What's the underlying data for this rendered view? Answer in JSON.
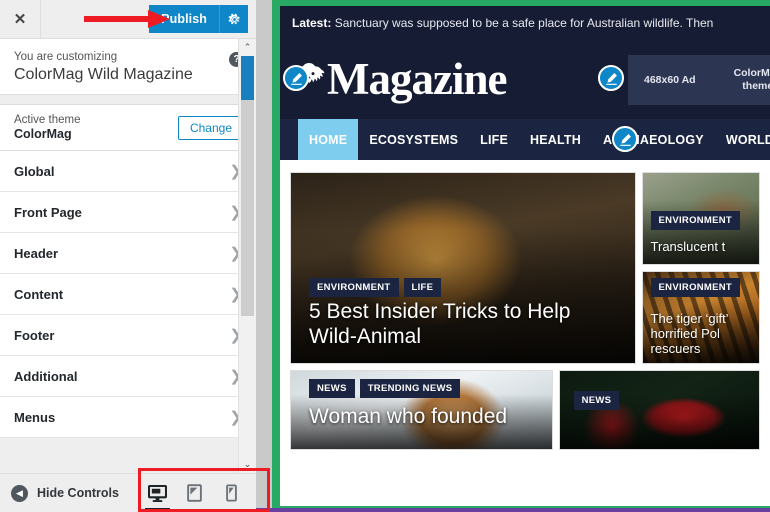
{
  "customizer": {
    "close_label": "✕",
    "publish_label": "Publish",
    "publish_gear_name": "gear-icon",
    "customizing_label": "You are customizing",
    "site_title": "ColorMag Wild Magazine",
    "help_label": "?",
    "active_theme_label": "Active theme",
    "active_theme_name": "ColorMag",
    "change_label": "Change",
    "panels": [
      {
        "label": "Global"
      },
      {
        "label": "Front Page"
      },
      {
        "label": "Header"
      },
      {
        "label": "Content"
      },
      {
        "label": "Footer"
      },
      {
        "label": "Additional"
      },
      {
        "label": "Menus"
      }
    ],
    "chevron": "❯",
    "footer": {
      "hide_controls_label": "Hide Controls",
      "devices": [
        {
          "name": "desktop",
          "active": true
        },
        {
          "name": "tablet",
          "active": false
        },
        {
          "name": "mobile",
          "active": false
        }
      ]
    },
    "scroll_up": "⌃",
    "scroll_down": "⌄"
  },
  "preview": {
    "ticker_prefix": "Latest:",
    "ticker_text": "Sanctuary was supposed to be a safe place for Australian wildlife. Then",
    "logo_text": "Magazine",
    "lion_glyph": "🦁",
    "ad": {
      "size_label": "468x60 Ad",
      "theme_line1": "ColorMag",
      "theme_line2": "theme"
    },
    "nav": [
      {
        "label": "HOME",
        "active": true
      },
      {
        "label": "ECOSYSTEMS",
        "active": false
      },
      {
        "label": "LIFE",
        "active": false
      },
      {
        "label": "HEALTH",
        "active": false
      },
      {
        "label": "ARCHAEOLOGY",
        "active": false
      },
      {
        "label": "WORLD",
        "active": false
      }
    ],
    "feature": {
      "categories": [
        "ENVIRONMENT",
        "LIFE"
      ],
      "title": "5 Best Insider Tricks to Help Wild-Animal"
    },
    "side_cards": [
      {
        "category": "ENVIRONMENT",
        "title": "Translucent t"
      },
      {
        "category": "ENVIRONMENT",
        "title": "The tiger ‘gift’ horrified Pol rescuers"
      }
    ],
    "bottom_cards": [
      {
        "categories": [
          "NEWS",
          "TRENDING NEWS"
        ],
        "title": "Woman who founded"
      },
      {
        "categories": [
          "NEWS"
        ],
        "title": ""
      }
    ]
  },
  "colors": {
    "publish_blue": "#0e86c7",
    "green_frame": "#28a964",
    "site_dark": "#151c33",
    "nav_dark": "#1b2440",
    "nav_active": "#7ecdef",
    "annotation_red": "#ee1b24"
  }
}
